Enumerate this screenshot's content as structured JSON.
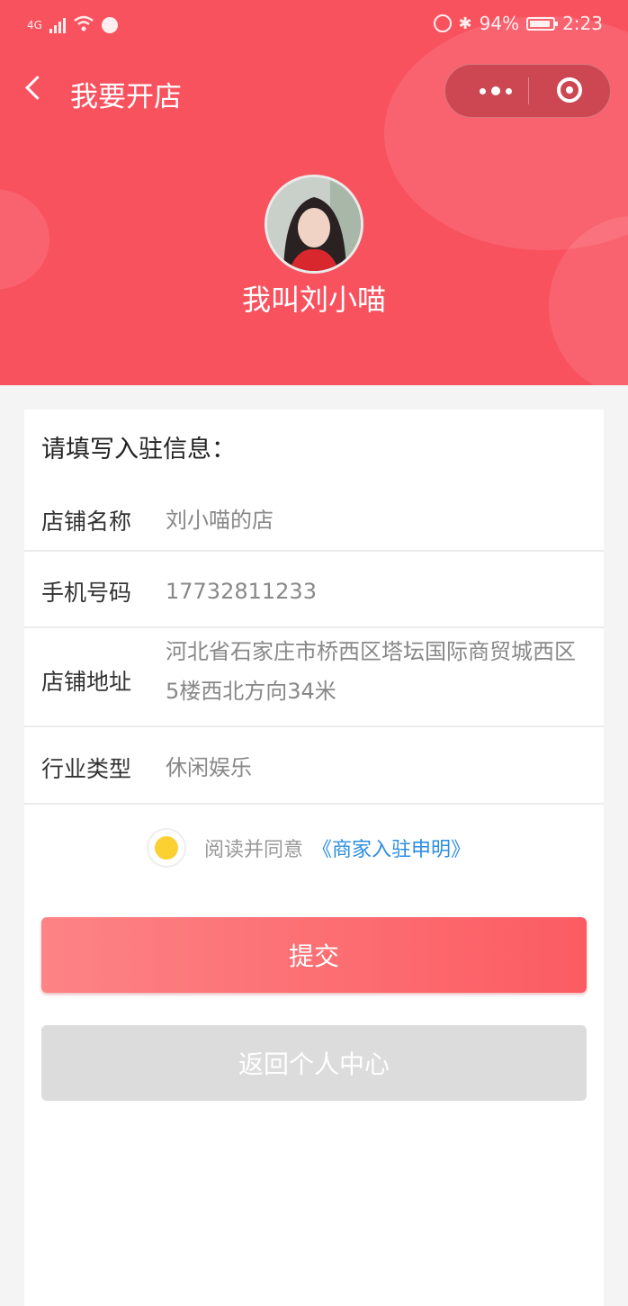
{
  "status_bar": {
    "network": "4G",
    "battery_percent": "94%",
    "time": "2:23"
  },
  "navbar": {
    "title": "我要开店",
    "back_icon": "chevron-left-icon",
    "more_icon": "more-dots-icon",
    "close_icon": "target-circle-icon"
  },
  "profile": {
    "name": "我叫刘小喵"
  },
  "form": {
    "title": "请填写入驻信息：",
    "fields": [
      {
        "label": "店铺名称",
        "value": "刘小喵的店"
      },
      {
        "label": "手机号码",
        "value": "17732811233"
      },
      {
        "label": "店铺地址",
        "value": "河北省石家庄市桥西区塔坛国际商贸城西区5楼西北方向34米"
      },
      {
        "label": "行业类型",
        "value": "休闲娱乐"
      }
    ]
  },
  "agreement": {
    "text": "阅读并同意",
    "link": "《商家入驻申明》",
    "checked": true
  },
  "buttons": {
    "submit": "提交",
    "back": "返回个人中心"
  },
  "colors": {
    "header_bg": "#f9525f",
    "accent_link": "#2d8ee0",
    "radio_fill": "#fbd032",
    "submit_start": "#fd8385",
    "submit_end": "#fb5c62",
    "disabled_btn": "#dcdcdc"
  }
}
